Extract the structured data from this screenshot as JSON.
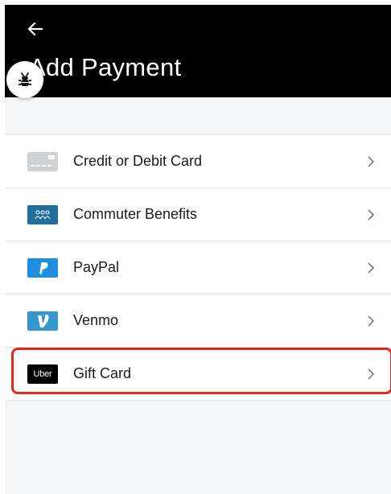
{
  "header": {
    "title": "Add Payment",
    "back_icon": "arrow-left-icon",
    "debug_icon": "bug-icon"
  },
  "payment_methods": [
    {
      "label": "Credit or Debit Card",
      "icon": "credit-card-icon"
    },
    {
      "label": "Commuter Benefits",
      "icon": "commuter-benefits-icon"
    },
    {
      "label": "PayPal",
      "icon": "paypal-icon"
    },
    {
      "label": "Venmo",
      "icon": "venmo-icon"
    },
    {
      "label": "Gift Card",
      "icon": "uber-gift-card-icon",
      "icon_text": "Uber",
      "highlighted": true
    }
  ],
  "colors": {
    "header_bg": "#000000",
    "page_bg": "#f5f6f8",
    "highlight": "#e0281b",
    "commuter": "#1f6e9c",
    "paypal": "#1d8fe0",
    "venmo": "#3396cd"
  }
}
